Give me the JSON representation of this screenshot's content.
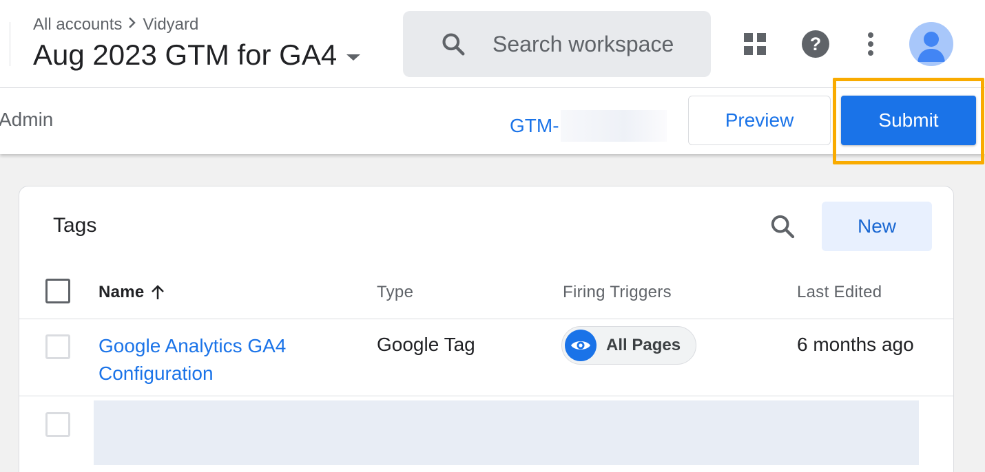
{
  "header": {
    "breadcrumb_root": "All accounts",
    "breadcrumb_account": "Vidyard",
    "container_name": "Aug 2023 GTM for GA4",
    "search_placeholder": "Search workspace"
  },
  "subbar": {
    "admin_label": "Admin",
    "container_id_prefix": "GTM-",
    "preview_label": "Preview",
    "submit_label": "Submit"
  },
  "tags": {
    "title": "Tags",
    "new_label": "New",
    "columns": {
      "name": "Name",
      "type": "Type",
      "triggers": "Firing Triggers",
      "edited": "Last Edited"
    },
    "rows": [
      {
        "name": "Google Analytics GA4 Configuration",
        "type": "Google Tag",
        "trigger": "All Pages",
        "edited": "6 months ago"
      }
    ]
  },
  "colors": {
    "accent": "#1a73e8",
    "highlight": "#f9ab00"
  }
}
